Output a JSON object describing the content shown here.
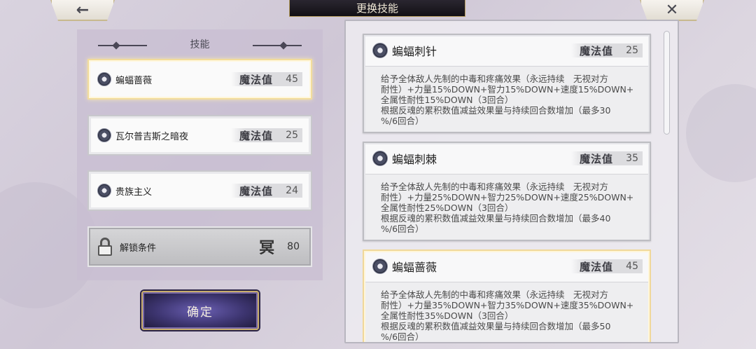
{
  "nav": {
    "back_icon": "←",
    "close_icon": "✕",
    "title": "更换技能"
  },
  "left": {
    "header": "技能",
    "skills": [
      {
        "name": "蝙蝠蔷薇",
        "mp_label": "魔法值",
        "mp": "45",
        "selected": true
      },
      {
        "name": "瓦尔普吉斯之暗夜",
        "mp_label": "魔法值",
        "mp": "25",
        "selected": false
      },
      {
        "name": "贵族主义",
        "mp_label": "魔法值",
        "mp": "24",
        "selected": false
      }
    ],
    "unlock": {
      "label": "解锁条件",
      "symbol": "冥",
      "value": "80"
    },
    "confirm": "确定"
  },
  "right": {
    "cards": [
      {
        "title": "蝙蝠刺针",
        "mp_label": "魔法值",
        "mp": "25",
        "desc": "给予全体敌人先制的中毒和疼痛效果（永远持续　无视对方\n耐性）+力量15%DOWN+智力15%DOWN+速度15%DOWN+\n全属性耐性15%DOWN（3回合）\n根据反魂的累积数值减益效果量与持续回合数增加（最多30\n%/6回合）"
      },
      {
        "title": "蝙蝠刺棘",
        "mp_label": "魔法值",
        "mp": "35",
        "desc": "给予全体敌人先制的中毒和疼痛效果（永远持续　无视对方\n耐性）+力量25%DOWN+智力25%DOWN+速度25%DOWN+\n全属性耐性25%DOWN（3回合）\n根据反魂的累积数值减益效果量与持续回合数增加（最多40\n%/6回合）"
      },
      {
        "title": "蝙蝠蔷薇",
        "mp_label": "魔法值",
        "mp": "45",
        "desc": "给予全体敌人先制的中毒和疼痛效果（永远持续　无视对方\n耐性）+力量35%DOWN+智力35%DOWN+速度35%DOWN+\n全属性耐性35%DOWN（3回合）\n根据反魂的累积数值减益效果量与持续回合数增加（最多50\n%/6回合）"
      }
    ]
  }
}
